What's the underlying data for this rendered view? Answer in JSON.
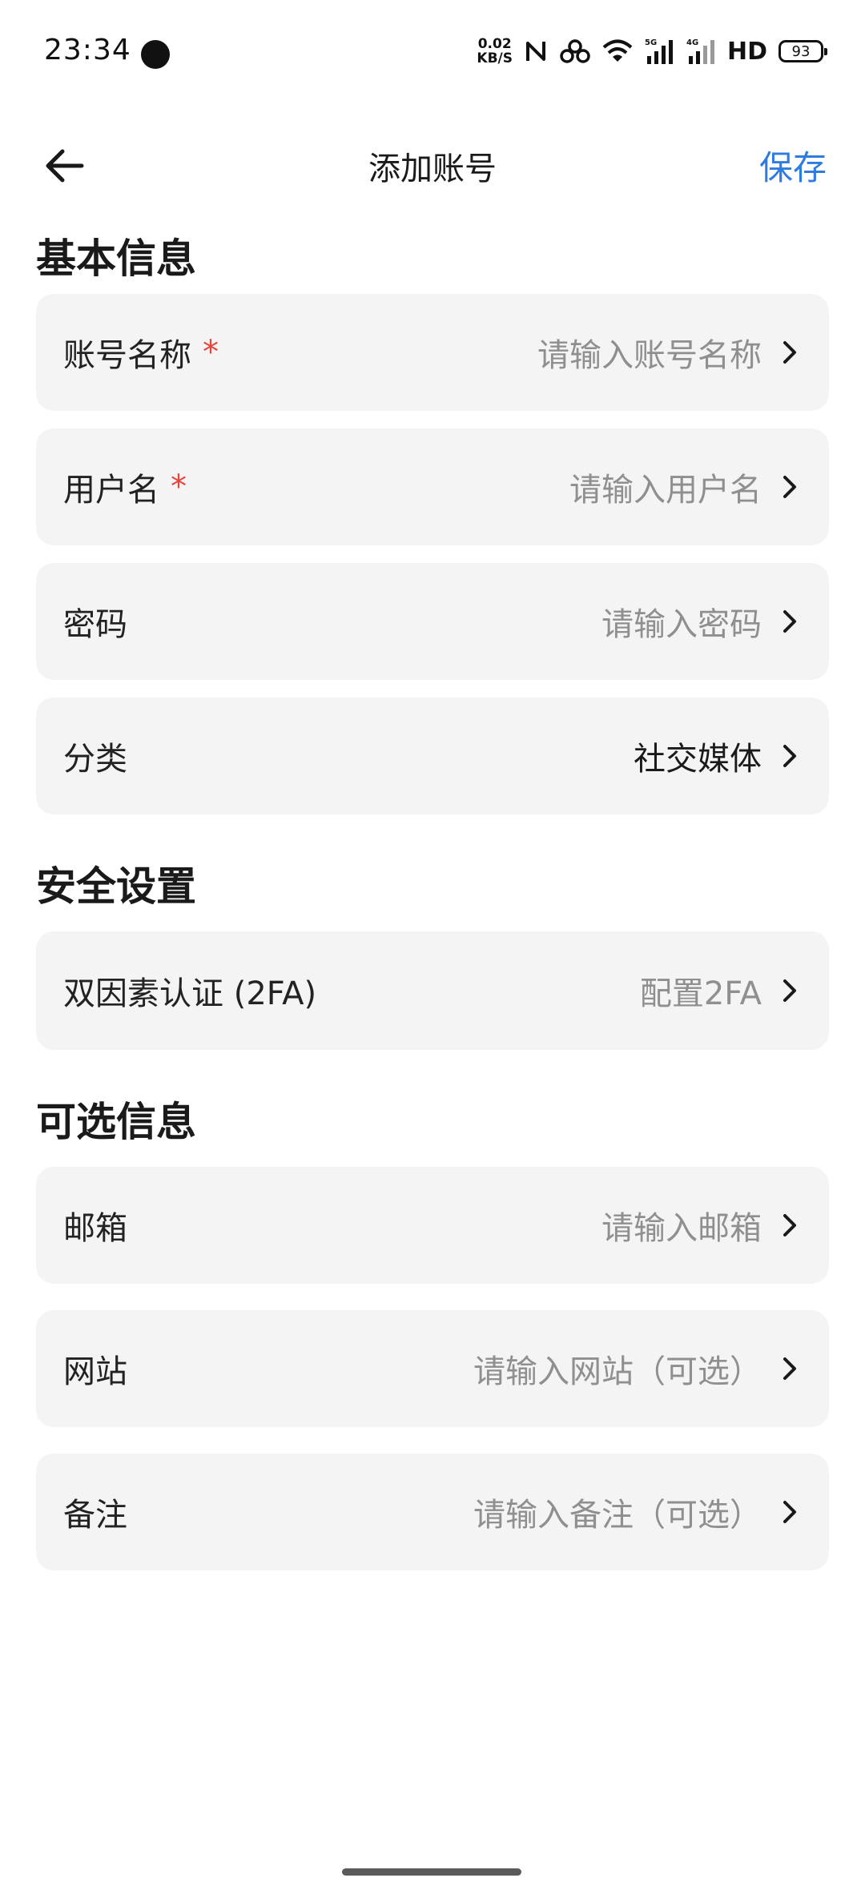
{
  "status_bar": {
    "time": "23:34",
    "net_speed_value": "0.02",
    "net_speed_unit": "KB/S",
    "hd_label": "HD",
    "battery": "93"
  },
  "header": {
    "title": "添加账号",
    "save_label": "保存"
  },
  "sections": {
    "basic": {
      "title": "基本信息",
      "account_name": {
        "label": "账号名称",
        "required_mark": "*",
        "placeholder": "请输入账号名称"
      },
      "username": {
        "label": "用户名",
        "required_mark": "*",
        "placeholder": "请输入用户名"
      },
      "password": {
        "label": "密码",
        "placeholder": "请输入密码"
      },
      "category": {
        "label": "分类",
        "value": "社交媒体"
      }
    },
    "security": {
      "title": "安全设置",
      "twofa": {
        "label": "双因素认证 (2FA)",
        "value": "配置2FA"
      }
    },
    "optional": {
      "title": "可选信息",
      "email": {
        "label": "邮箱",
        "placeholder": "请输入邮箱"
      },
      "website": {
        "label": "网站",
        "placeholder": "请输入网站（可选）"
      },
      "note": {
        "label": "备注",
        "placeholder": "请输入备注（可选）"
      }
    }
  },
  "colors": {
    "accent": "#2f7ce0",
    "required": "#e5443a",
    "card_bg": "#f4f4f4",
    "placeholder": "#8f8f8f"
  }
}
